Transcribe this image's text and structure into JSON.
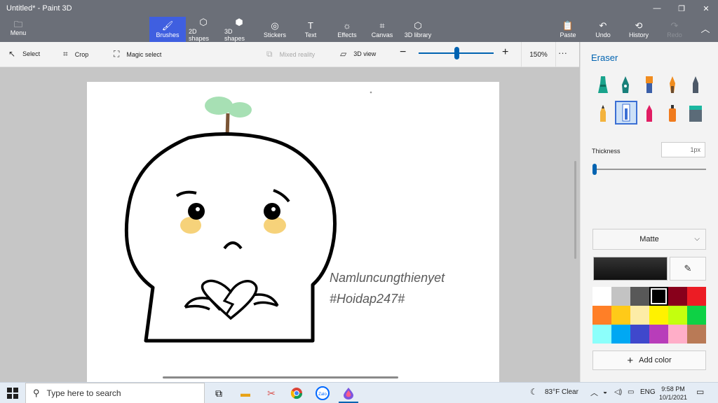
{
  "window": {
    "title": "Untitled* - Paint 3D",
    "minimize": "—",
    "maximize": "❐",
    "close": "✕"
  },
  "menu": {
    "label": "Menu",
    "icon": "folder-icon"
  },
  "tools": [
    {
      "label": "Brushes",
      "icon": "brush-icon"
    },
    {
      "label": "2D shapes",
      "icon": "shapes-2d-icon"
    },
    {
      "label": "3D shapes",
      "icon": "cube-icon"
    },
    {
      "label": "Stickers",
      "icon": "sticker-icon"
    },
    {
      "label": "Text",
      "icon": "text-icon"
    },
    {
      "label": "Effects",
      "icon": "effects-icon"
    },
    {
      "label": "Canvas",
      "icon": "canvas-icon"
    },
    {
      "label": "3D library",
      "icon": "library-icon"
    }
  ],
  "actions": [
    {
      "label": "Paste",
      "icon": "paste-icon"
    },
    {
      "label": "Undo",
      "icon": "undo-icon"
    },
    {
      "label": "History",
      "icon": "history-icon"
    },
    {
      "label": "Redo",
      "icon": "redo-icon"
    }
  ],
  "toolbar2": {
    "select": "Select",
    "crop": "Crop",
    "magic_select": "Magic select",
    "mixed_reality": "Mixed reality",
    "view_3d": "3D view",
    "zoom_level": "150%",
    "zoom_fraction": 0.5
  },
  "canvas": {
    "signature_line1": "Namluncungthienyet",
    "signature_line2": "#Hoidap247#"
  },
  "panel": {
    "title": "Eraser",
    "thickness_label": "Thickness",
    "thickness_value": "1px",
    "finish": "Matte",
    "add_color": "Add color",
    "selected_color": "#000000",
    "palette": [
      "#ffffff",
      "#c3c3c3",
      "#585858",
      "#000000",
      "#88001b",
      "#ec1c24",
      "#ff7f27",
      "#ffca18",
      "#fdeca6",
      "#fff200",
      "#c4ff0e",
      "#0ed145",
      "#8cfffb",
      "#00a8f3",
      "#3f48cc",
      "#b83dba",
      "#ffaec8",
      "#b97a56"
    ]
  },
  "taskbar": {
    "search_placeholder": "Type here to search",
    "weather": "83°F  Clear",
    "language": "ENG",
    "time": "9:58 PM",
    "date": "10/1/2021",
    "zalo": "Zalo"
  }
}
